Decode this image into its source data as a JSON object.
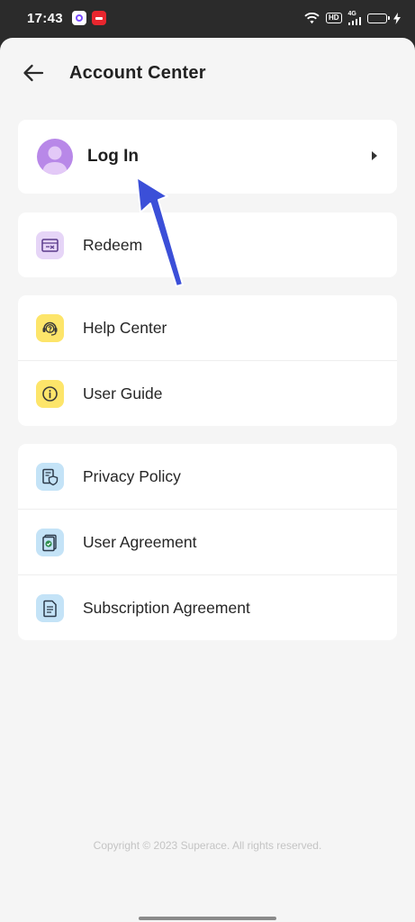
{
  "status_bar": {
    "time": "17:43",
    "hd_label": "HD",
    "network_label": "4G"
  },
  "header": {
    "title": "Account Center",
    "back_icon": "arrow-left-icon"
  },
  "login": {
    "label": "Log In",
    "avatar_icon": "user-avatar-icon",
    "chevron_icon": "chevron-right-icon"
  },
  "groups": {
    "redeem": {
      "label": "Redeem",
      "icon": "ticket-icon"
    },
    "help_center": {
      "label": "Help Center",
      "icon": "headset-question-icon"
    },
    "user_guide": {
      "label": "User Guide",
      "icon": "info-icon"
    },
    "privacy_policy": {
      "label": "Privacy Policy",
      "icon": "document-shield-icon"
    },
    "user_agreement": {
      "label": "User Agreement",
      "icon": "document-check-icon"
    },
    "subscription_agreement": {
      "label": "Subscription Agreement",
      "icon": "document-lines-icon"
    }
  },
  "footer": {
    "copyright": "Copyright © 2023 Superace. All rights reserved."
  },
  "colors": {
    "background": "#f5f5f5",
    "card": "#ffffff",
    "accent_purple": "#b888e8",
    "icon_purple_bg": "#e6d5f7",
    "icon_yellow_bg": "#fde56a",
    "icon_blue_bg": "#c4e3f7",
    "annotation_arrow": "#3b4fd8"
  }
}
